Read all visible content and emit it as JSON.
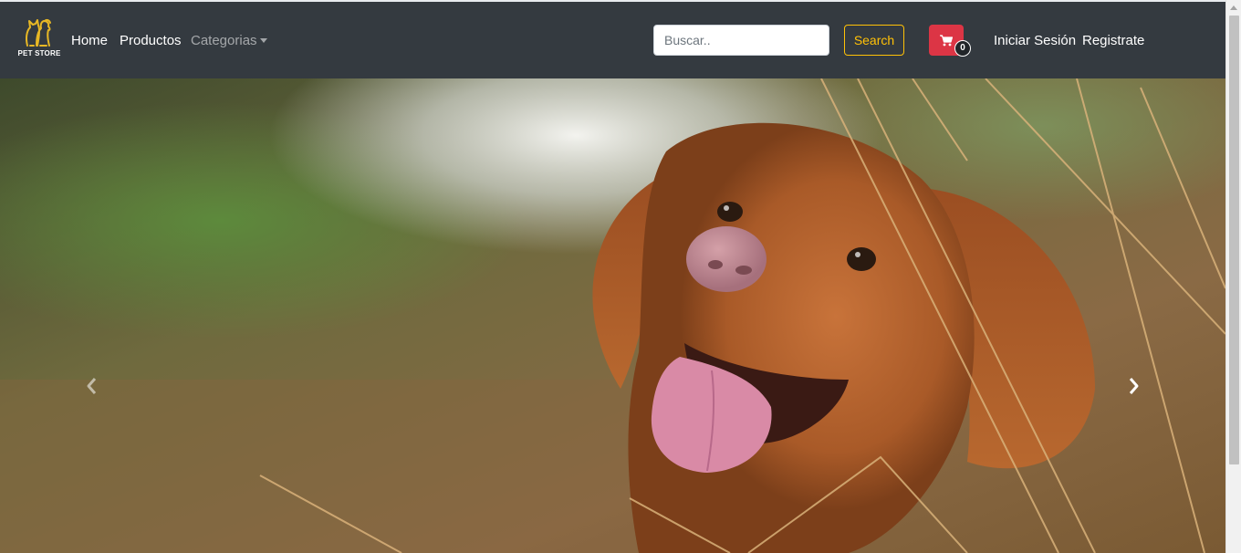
{
  "brand": {
    "name": "PET STORE",
    "logo_icon": "cat-and-dog-icon",
    "color": "#e8b825"
  },
  "nav": {
    "home": "Home",
    "productos": "Productos",
    "categorias": "Categorias",
    "login": "Iniciar Sesión",
    "register": "Registrate"
  },
  "search": {
    "placeholder": "Buscar..",
    "button_label": "Search"
  },
  "cart": {
    "icon": "shopping-cart-icon",
    "count": "0",
    "color": "#dc3545"
  },
  "hero": {
    "image": "dog-with-tongue-out-photo",
    "prev_icon": "chevron-left-icon",
    "next_icon": "chevron-right-icon"
  },
  "colors": {
    "navbar": "#343a40",
    "accent": "#ffc107",
    "danger": "#dc3545"
  }
}
